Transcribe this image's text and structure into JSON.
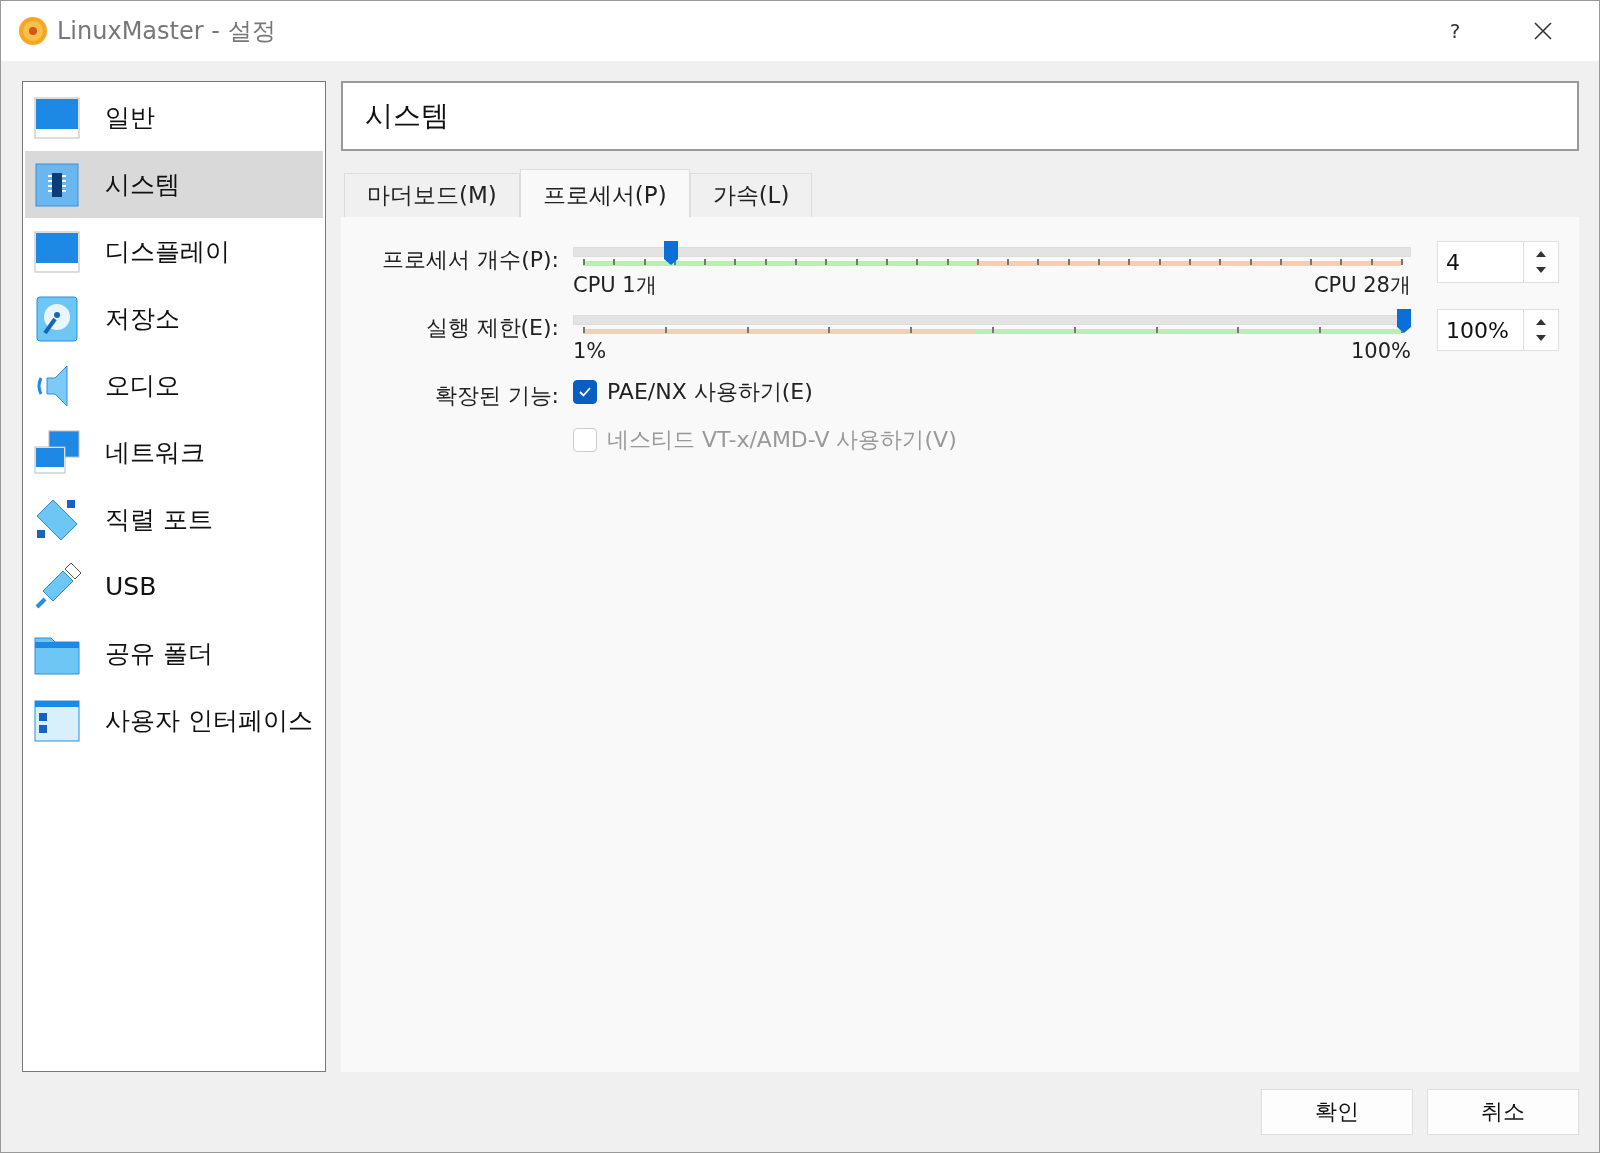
{
  "window": {
    "title": "LinuxMaster - 설정",
    "help": "?"
  },
  "sidebar": {
    "items": [
      {
        "label": "일반",
        "kind": "general",
        "selected": false
      },
      {
        "label": "시스템",
        "kind": "system",
        "selected": true
      },
      {
        "label": "디스플레이",
        "kind": "display",
        "selected": false
      },
      {
        "label": "저장소",
        "kind": "storage",
        "selected": false
      },
      {
        "label": "오디오",
        "kind": "audio",
        "selected": false
      },
      {
        "label": "네트워크",
        "kind": "network",
        "selected": false
      },
      {
        "label": "직렬 포트",
        "kind": "serial",
        "selected": false
      },
      {
        "label": "USB",
        "kind": "usb",
        "selected": false
      },
      {
        "label": "공유 폴더",
        "kind": "folder",
        "selected": false
      },
      {
        "label": "사용자 인터페이스",
        "kind": "ui",
        "selected": false
      }
    ]
  },
  "page_title": "시스템",
  "tabs": [
    {
      "label": "마더보드(M)",
      "selected": false
    },
    {
      "label": "프로세서(P)",
      "selected": true
    },
    {
      "label": "가속(L)",
      "selected": false
    }
  ],
  "sliders": [
    {
      "label": "프로세서 개수(P):",
      "kind": "cpu",
      "level": 0.111,
      "min_label": "CPU 1개",
      "max_label": "CPU 28개",
      "value": "4"
    },
    {
      "label": "실행 제한(E):",
      "kind": "cap",
      "level": 1.0,
      "min_label": "1%",
      "max_label": "100%",
      "value": "100%"
    }
  ],
  "features": {
    "label": "확장된 기능:",
    "options": [
      {
        "label": "PAE/NX 사용하기(E)",
        "checked": true,
        "disabled": false
      },
      {
        "label": "네스티드 VT-x/AMD-V 사용하기(V)",
        "checked": false,
        "disabled": true
      }
    ]
  },
  "buttons": [
    "확인",
    "취소"
  ]
}
